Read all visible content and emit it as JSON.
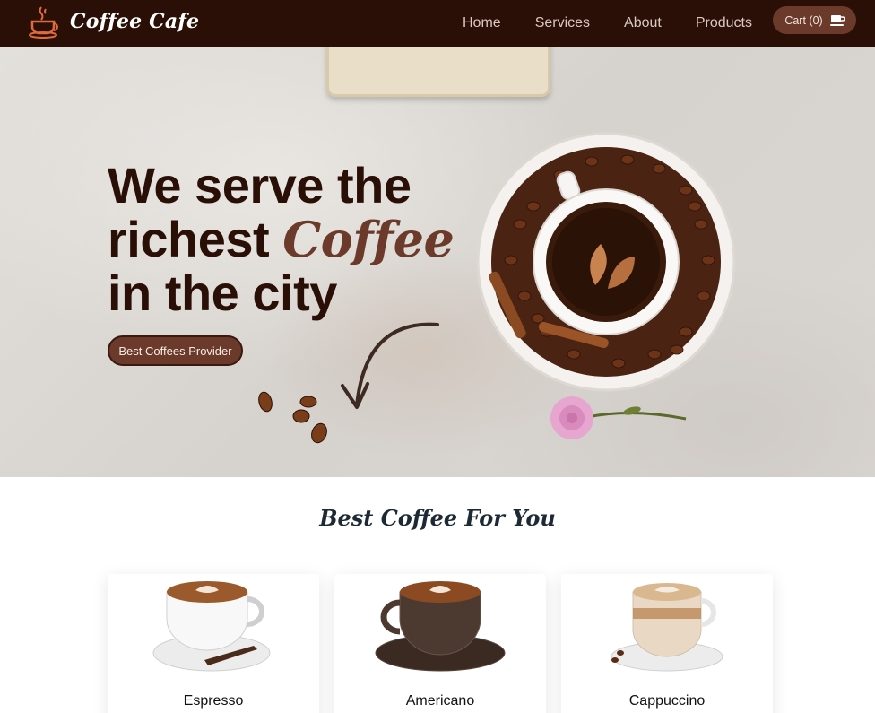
{
  "header": {
    "brand": "Coffee Cafe",
    "nav": [
      "Home",
      "Services",
      "About",
      "Products"
    ],
    "cart_label": "Cart (0)"
  },
  "hero": {
    "headline_line1": "We serve the",
    "headline_line2": "richest",
    "headline_accent": "Coffee",
    "headline_line3": "in the city",
    "cta_label": "Best Coffees Provider"
  },
  "products": {
    "title": "Best Coffee For You",
    "items": [
      "Espresso",
      "Americano",
      "Cappuccino"
    ]
  },
  "colors": {
    "header_bg": "#2a0f07",
    "accent": "#6b3a2a",
    "text_dark": "#2a0f07"
  }
}
